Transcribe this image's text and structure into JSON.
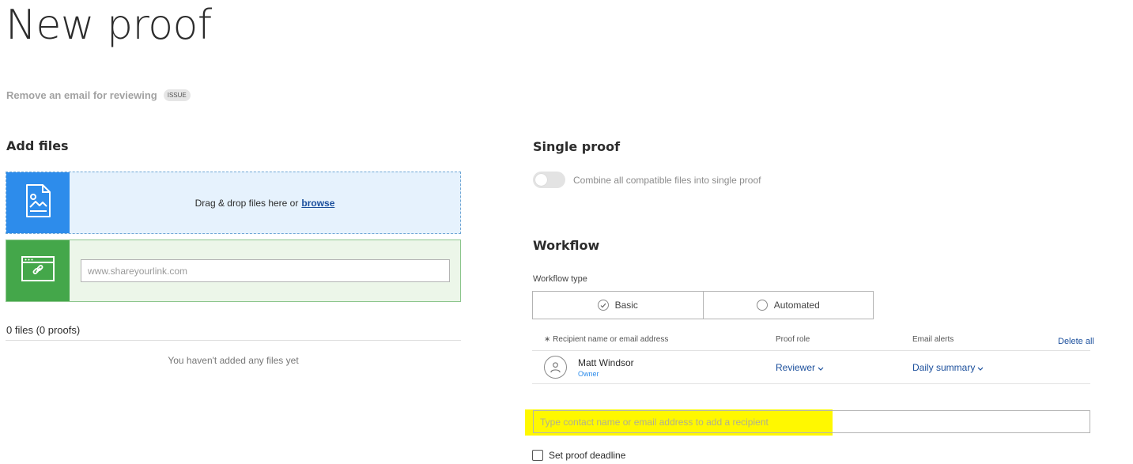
{
  "page": {
    "title": "New proof",
    "subtitle": "Remove an email for reviewing",
    "badge": "ISSUE"
  },
  "add_files": {
    "title": "Add files",
    "drop_text": "Drag & drop files here or",
    "browse_label": "browse",
    "link_placeholder": "www.shareyourlink.com",
    "files_count": "0 files (0 proofs)",
    "empty_message": "You haven't added any files yet"
  },
  "single_proof": {
    "title": "Single proof",
    "toggle_label": "Combine all compatible files into single proof",
    "toggle_on": false
  },
  "workflow": {
    "title": "Workflow",
    "type_label": "Workflow type",
    "options": [
      {
        "label": "Basic",
        "selected": true
      },
      {
        "label": "Automated",
        "selected": false
      }
    ]
  },
  "recipients": {
    "columns": {
      "name": "∗ Recipient name or email address",
      "role": "Proof role",
      "alerts": "Email alerts"
    },
    "delete_all": "Delete all",
    "rows": [
      {
        "name": "Matt Windsor",
        "tag": "Owner",
        "role": "Reviewer",
        "alerts": "Daily summary"
      }
    ],
    "add_placeholder": "Type contact name or email address to add a recipient"
  },
  "deadline": {
    "label": "Set proof deadline",
    "checked": false
  },
  "icons": {
    "file_tile": "file-image-icon",
    "link_tile": "browser-link-icon",
    "avatar": "user-icon",
    "dropdown": "chevron-down-icon",
    "radio_selected": "check-icon"
  },
  "colors": {
    "file_tile": "#2d8ceb",
    "link_tile": "#44a74a",
    "link_text": "#1b4f9c",
    "highlight": "#fff800"
  }
}
